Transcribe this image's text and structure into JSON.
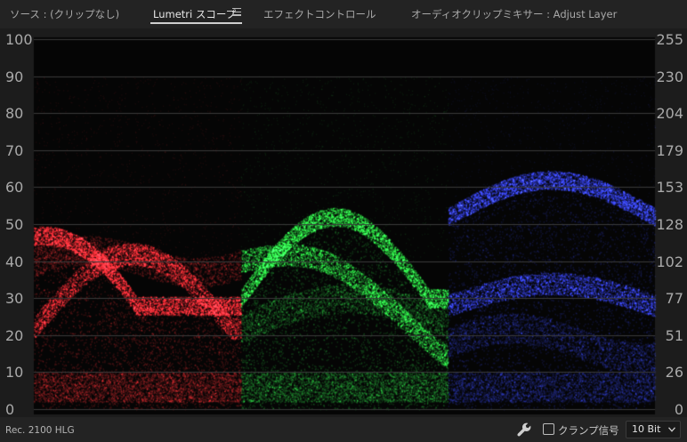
{
  "tabs": [
    {
      "label": "ソース : (クリップなし)",
      "active": false
    },
    {
      "label": "Lumetri スコープ",
      "active": true
    },
    {
      "label": "エフェクトコントロール",
      "active": false
    },
    {
      "label": "オーディオクリップミキサー : Adjust Layer",
      "active": false
    }
  ],
  "scope": {
    "left_scale": [
      "100",
      "90",
      "80",
      "70",
      "60",
      "50",
      "40",
      "30",
      "20",
      "10",
      "0"
    ],
    "right_scale": [
      "255",
      "230",
      "204",
      "179",
      "153",
      "128",
      "102",
      "77",
      "51",
      "26",
      "0"
    ],
    "channel_colors": {
      "red": "#e8222a",
      "green": "#22d23a",
      "blue": "#2a36d8"
    },
    "background": "#050505",
    "grid_color": "#3a3a3a"
  },
  "status": {
    "color_space": "Rec. 2100 HLG",
    "clamp_label": "クランプ信号",
    "clamp_checked": false,
    "bit_depth": "10 Bit"
  },
  "icons": {
    "menu": "hamburger-menu-icon",
    "settings": "wrench-icon",
    "dropdown": "chevron-down-icon"
  }
}
